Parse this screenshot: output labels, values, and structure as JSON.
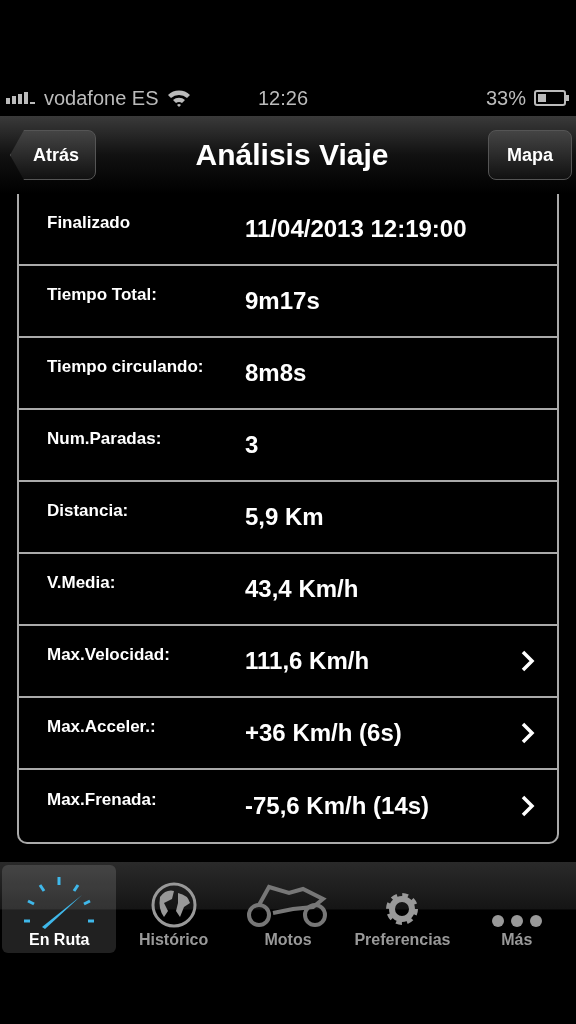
{
  "status_bar": {
    "carrier": "vodafone ES",
    "time": "12:26",
    "battery": "33%"
  },
  "nav": {
    "back": "Atrás",
    "title": "Análisis Viaje",
    "right": "Mapa"
  },
  "rows": [
    {
      "label": "Finalizado",
      "value": "11/04/2013 12:19:00",
      "disclosure": false
    },
    {
      "label": "Tiempo Total:",
      "value": "9m17s",
      "disclosure": false
    },
    {
      "label": "Tiempo circulando:",
      "value": "8m8s",
      "disclosure": false
    },
    {
      "label": "Num.Paradas:",
      "value": "3",
      "disclosure": false
    },
    {
      "label": "Distancia:",
      "value": "5,9 Km",
      "disclosure": false
    },
    {
      "label": "V.Media:",
      "value": "43,4 Km/h",
      "disclosure": false
    },
    {
      "label": "Max.Velocidad:",
      "value": "111,6 Km/h",
      "disclosure": true
    },
    {
      "label": "Max.Acceler.:",
      "value": "+36 Km/h (6s)",
      "disclosure": true
    },
    {
      "label": "Max.Frenada:",
      "value": "-75,6 Km/h (14s)",
      "disclosure": true
    }
  ],
  "tabs": [
    {
      "label": "En Ruta",
      "kind": "gauge",
      "selected": true
    },
    {
      "label": "Histórico",
      "kind": "globe",
      "selected": false
    },
    {
      "label": "Motos",
      "kind": "motorbike",
      "selected": false
    },
    {
      "label": "Preferencias",
      "kind": "gear",
      "selected": false
    },
    {
      "label": "Más",
      "kind": "more",
      "selected": false
    }
  ]
}
